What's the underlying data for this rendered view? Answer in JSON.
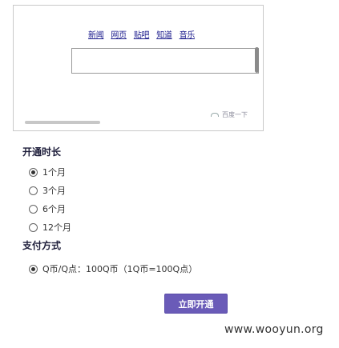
{
  "embed": {
    "nav_links": [
      "新闻",
      "网页",
      "贴吧",
      "知道",
      "音乐"
    ],
    "search": {
      "value": "",
      "placeholder": ""
    },
    "small_link_label": "百度一下"
  },
  "duration": {
    "title": "开通时长",
    "options": [
      "1个月",
      "3个月",
      "6个月",
      "12个月"
    ],
    "selected": "1个月"
  },
  "payment": {
    "title": "支付方式",
    "option_label": "Q币/Q点：100Q币（1Q币=100Q点）",
    "selected": true
  },
  "submit_label": "立即开通",
  "watermark": "www.wooyun.org",
  "colors": {
    "button_bg": "#6a5bb8",
    "link_color": "#1a1a8c"
  }
}
